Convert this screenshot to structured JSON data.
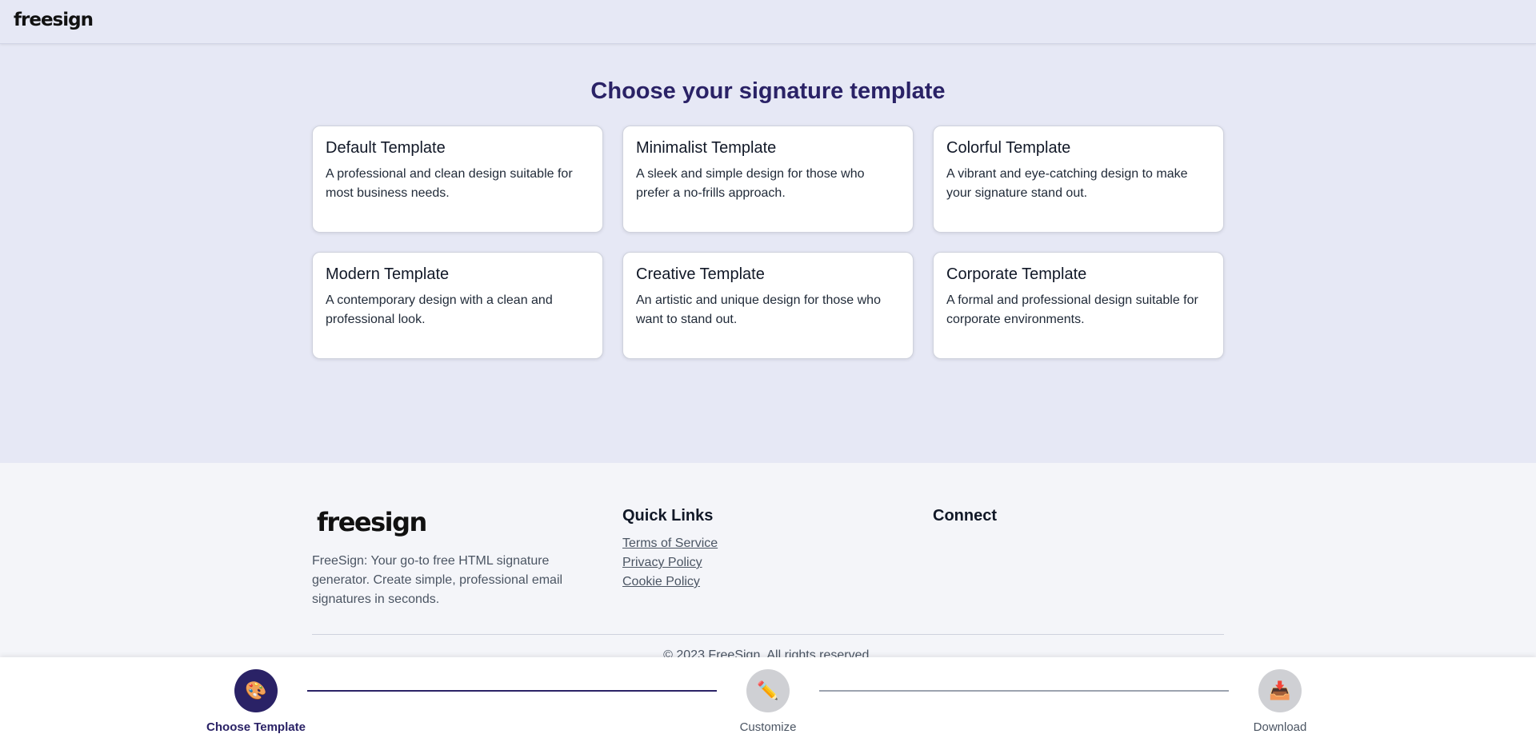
{
  "header": {
    "logo": "freesign"
  },
  "main": {
    "heading": "Choose your signature template",
    "templates": [
      {
        "title": "Default Template",
        "description": "A professional and clean design suitable for most business needs."
      },
      {
        "title": "Minimalist Template",
        "description": "A sleek and simple design for those who prefer a no-frills approach."
      },
      {
        "title": "Colorful Template",
        "description": "A vibrant and eye-catching design to make your signature stand out."
      },
      {
        "title": "Modern Template",
        "description": "A contemporary design with a clean and professional look."
      },
      {
        "title": "Creative Template",
        "description": "An artistic and unique design for those who want to stand out."
      },
      {
        "title": "Corporate Template",
        "description": "A formal and professional design suitable for corporate environments."
      }
    ]
  },
  "footer": {
    "logo": "freesign",
    "about": "FreeSign: Your go-to free HTML signature generator. Create simple, professional email signatures in seconds.",
    "quick_links_heading": "Quick Links",
    "links": [
      "Terms of Service",
      "Privacy Policy",
      "Cookie Policy"
    ],
    "connect_heading": "Connect",
    "copyright": "© 2023 FreeSign. All rights reserved."
  },
  "stepper": {
    "steps": [
      {
        "label": "Choose Template",
        "icon": "palette-icon",
        "glyph": "🎨",
        "state": "active"
      },
      {
        "label": "Customize",
        "icon": "pencil-icon",
        "glyph": "✏️",
        "state": "inactive"
      },
      {
        "label": "Download",
        "icon": "inbox-tray-icon",
        "glyph": "📥",
        "state": "inactive"
      }
    ],
    "colors": {
      "active": "#2a2266",
      "inactive": "#cfd0d4",
      "line_done": "#2a2266",
      "line_pending": "#9ca3af"
    }
  }
}
